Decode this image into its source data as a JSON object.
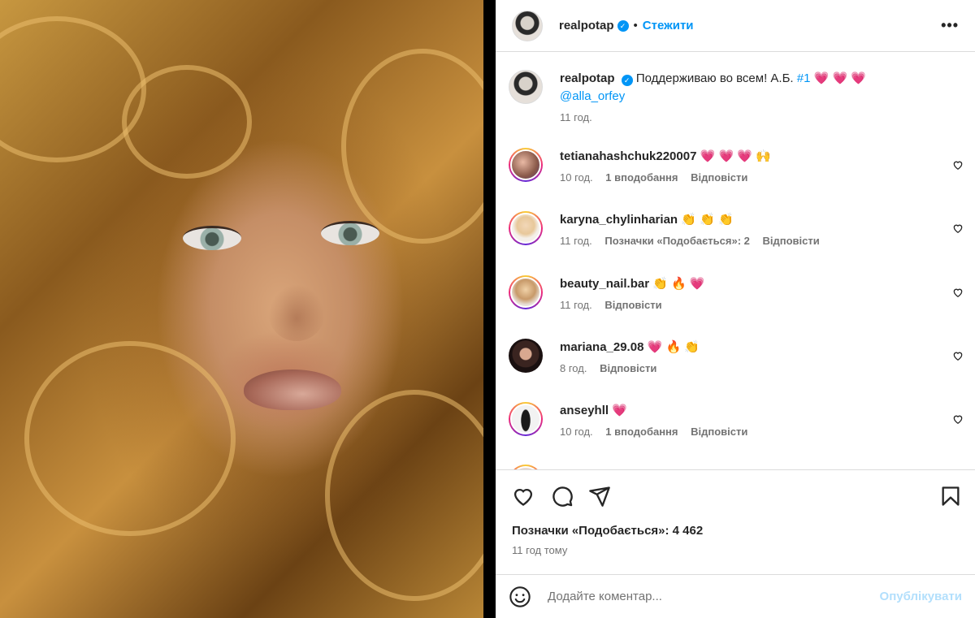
{
  "post": {
    "author": "realpotap",
    "follow_label": "Стежити",
    "dot": "•",
    "more_label": "•••"
  },
  "caption": {
    "author": "realpotap",
    "text": "Поддерживаю во всем! А.Б.",
    "hashtag": "#1",
    "emoji": "💗 💗 💗",
    "mention": "@alla_orfey",
    "time": "11 год."
  },
  "comments": [
    {
      "user": "tetianahashchuk220007",
      "text": "💗 💗 💗 🙌",
      "time": "10 год.",
      "likes": "1 вподобання",
      "reply": "Відповісти"
    },
    {
      "user": "karyna_chylinharian",
      "text": "👏 👏 👏",
      "time": "11 год.",
      "likes": "Позначки «Подобається»: 2",
      "reply": "Відповісти"
    },
    {
      "user": "beauty_nail.bar",
      "text": "👏 🔥 💗",
      "time": "11 год.",
      "likes": "",
      "reply": "Відповісти"
    },
    {
      "user": "mariana_29.08",
      "text": "💗 🔥 👏",
      "time": "8 год.",
      "likes": "",
      "reply": "Відповісти"
    },
    {
      "user": "anseyhll",
      "text": "💗",
      "time": "10 год.",
      "likes": "1 вподобання",
      "reply": "Відповісти"
    }
  ],
  "footer": {
    "likes_count": "Позначки «Подобається»: 4 462",
    "time_ago": "11 год тому",
    "comment_placeholder": "Додайте коментар...",
    "publish_label": "Опублікувати"
  },
  "colors": {
    "accent": "#0095f6",
    "publish_disabled": "#b2dffc",
    "link": "#00376b",
    "heart": "#ff3b6b"
  }
}
